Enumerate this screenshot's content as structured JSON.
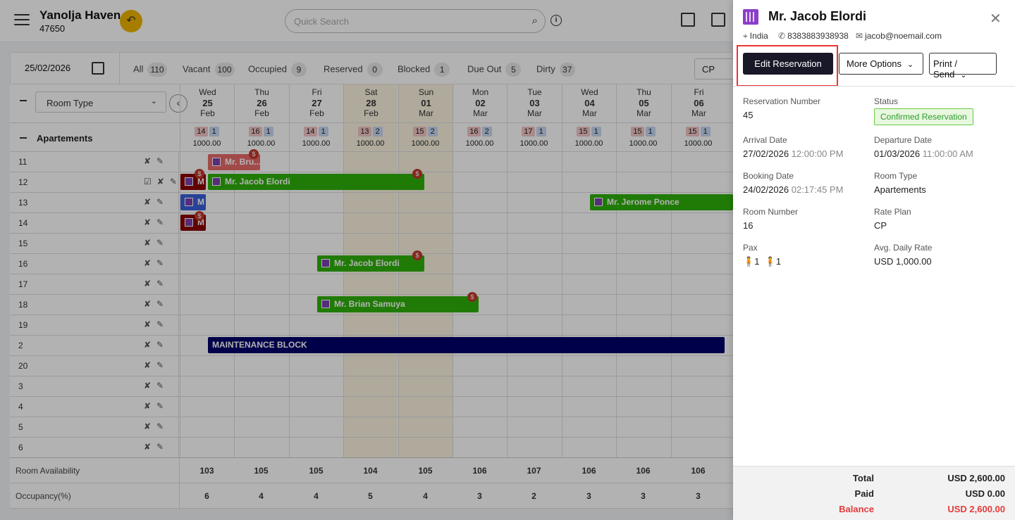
{
  "header": {
    "hotel_name": "Yanolja Haven",
    "hotel_id": "47650",
    "search_placeholder": "Quick Search"
  },
  "filters": {
    "date": "25/02/2026",
    "stats": [
      {
        "label": "All",
        "count": "110"
      },
      {
        "label": "Vacant",
        "count": "100"
      },
      {
        "label": "Occupied",
        "count": "9"
      },
      {
        "label": "Reserved",
        "count": "0"
      },
      {
        "label": "Blocked",
        "count": "1"
      },
      {
        "label": "Due Out",
        "count": "5"
      },
      {
        "label": "Dirty",
        "count": "37"
      }
    ],
    "rate_plan": "CP",
    "room_type": "Room Type"
  },
  "dates": [
    {
      "dow": "Wed",
      "day": "25",
      "mon": "Feb",
      "a": "14",
      "b": "1",
      "rate": "1000.00",
      "weekend": false
    },
    {
      "dow": "Thu",
      "day": "26",
      "mon": "Feb",
      "a": "16",
      "b": "1",
      "rate": "1000.00",
      "weekend": false
    },
    {
      "dow": "Fri",
      "day": "27",
      "mon": "Feb",
      "a": "14",
      "b": "1",
      "rate": "1000.00",
      "weekend": false
    },
    {
      "dow": "Sat",
      "day": "28",
      "mon": "Feb",
      "a": "13",
      "b": "2",
      "rate": "1000.00",
      "weekend": true
    },
    {
      "dow": "Sun",
      "day": "01",
      "mon": "Mar",
      "a": "15",
      "b": "2",
      "rate": "1000.00",
      "weekend": true
    },
    {
      "dow": "Mon",
      "day": "02",
      "mon": "Mar",
      "a": "16",
      "b": "2",
      "rate": "1000.00",
      "weekend": false
    },
    {
      "dow": "Tue",
      "day": "03",
      "mon": "Mar",
      "a": "17",
      "b": "1",
      "rate": "1000.00",
      "weekend": false
    },
    {
      "dow": "Wed",
      "day": "04",
      "mon": "Mar",
      "a": "15",
      "b": "1",
      "rate": "1000.00",
      "weekend": false
    },
    {
      "dow": "Thu",
      "day": "05",
      "mon": "Mar",
      "a": "15",
      "b": "1",
      "rate": "1000.00",
      "weekend": false
    },
    {
      "dow": "Fri",
      "day": "06",
      "mon": "Mar",
      "a": "15",
      "b": "1",
      "rate": "1000.00",
      "weekend": false
    }
  ],
  "group": {
    "label": "Apartements"
  },
  "rooms": [
    "11",
    "12",
    "13",
    "14",
    "15",
    "16",
    "17",
    "18",
    "19",
    "2",
    "20",
    "3",
    "4",
    "5",
    "6"
  ],
  "reservations": {
    "r1": "Mr. Bru...",
    "r2": "Mr. Jacob Elordi",
    "r3": "Mr. Jerome Ponce",
    "r4": "Mr. Jacob Elordi",
    "r5": "Mr. Brian Samuya",
    "r6": "MAINTENANCE BLOCK",
    "m12": "M",
    "m13": "M",
    "m14": "M"
  },
  "footer": {
    "availability_label": "Room Availability",
    "availability": [
      "103",
      "105",
      "105",
      "104",
      "105",
      "106",
      "107",
      "106",
      "106",
      "106"
    ],
    "occupancy_label": "Occupancy(%)",
    "occupancy": [
      "6",
      "4",
      "4",
      "5",
      "4",
      "3",
      "2",
      "3",
      "3",
      "3"
    ]
  },
  "drawer": {
    "guest_name": "Mr. Jacob Elordi",
    "country": "India",
    "phone": "8383883938938",
    "email": "jacob@noemail.com",
    "edit_label": "Edit Reservation",
    "more_label": "More Options",
    "print_label": "Print / Send",
    "fields": {
      "res_num_label": "Reservation Number",
      "res_num": "45",
      "status_label": "Status",
      "status": "Confirmed Reservation",
      "arrival_label": "Arrival Date",
      "arrival_date": "27/02/2026",
      "arrival_time": "12:00:00 PM",
      "departure_label": "Departure Date",
      "departure_date": "01/03/2026",
      "departure_time": "11:00:00 AM",
      "booking_label": "Booking Date",
      "booking_date": "24/02/2026",
      "booking_time": "02:17:45 PM",
      "room_type_label": "Room Type",
      "room_type": "Apartements",
      "room_num_label": "Room Number",
      "room_num": "16",
      "rate_plan_label": "Rate Plan",
      "rate_plan": "CP",
      "pax_label": "Pax",
      "adults": "1",
      "children": "1",
      "adr_label": "Avg. Daily Rate",
      "adr": "USD 1,000.00"
    },
    "totals": {
      "total_label": "Total",
      "total": "USD 2,600.00",
      "paid_label": "Paid",
      "paid": "USD 0.00",
      "balance_label": "Balance",
      "balance": "USD 2,600.00"
    }
  }
}
